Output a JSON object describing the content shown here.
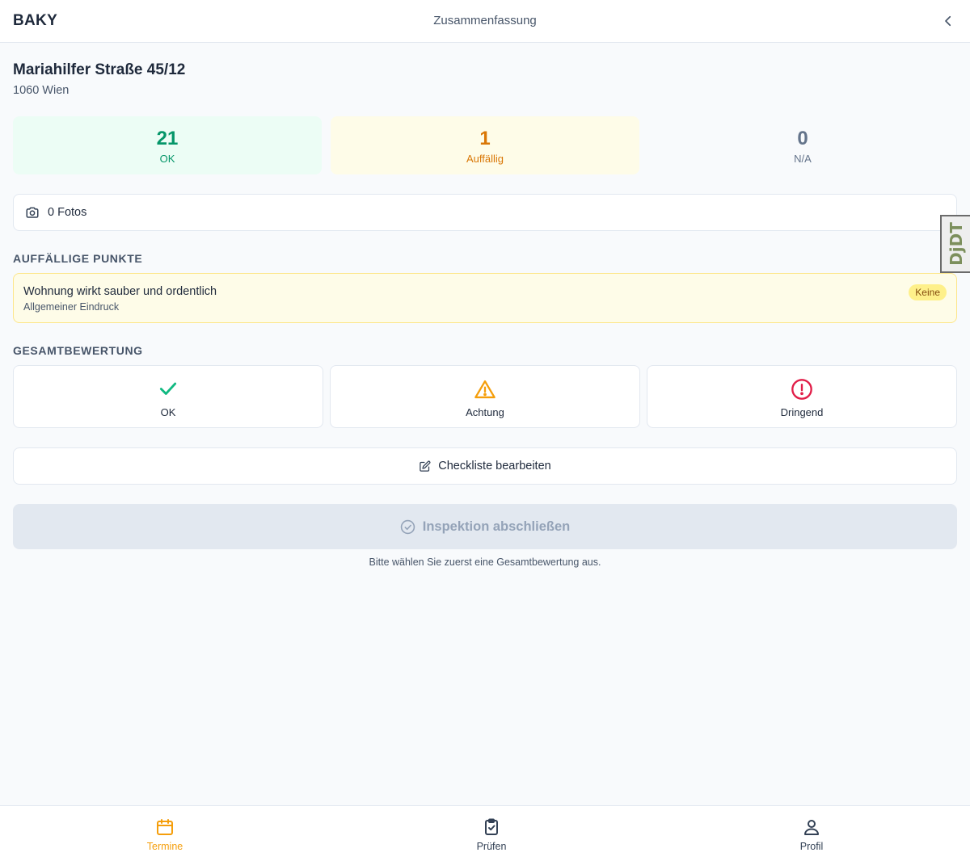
{
  "header": {
    "brand": "BAKY",
    "title": "Zusammenfassung"
  },
  "address": {
    "street": "Mariahilfer Straße 45/12",
    "city": "1060 Wien"
  },
  "stats": [
    {
      "value": "21",
      "label": "OK"
    },
    {
      "value": "1",
      "label": "Auffällig"
    },
    {
      "value": "0",
      "label": "N/A"
    }
  ],
  "photos": {
    "label": "0 Fotos"
  },
  "findings": {
    "section_title": "AUFFÄLLIGE PUNKTE",
    "items": [
      {
        "title": "Wohnung wirkt sauber und ordentlich",
        "category": "Allgemeiner Eindruck",
        "badge": "Keine"
      }
    ]
  },
  "rating": {
    "section_title": "GESAMTBEWERTUNG",
    "options": [
      {
        "label": "OK",
        "icon": "check-icon",
        "color": "#10b981"
      },
      {
        "label": "Achtung",
        "icon": "warning-triangle-icon",
        "color": "#f59e0b"
      },
      {
        "label": "Dringend",
        "icon": "alert-circle-icon",
        "color": "#e11d48"
      }
    ]
  },
  "actions": {
    "edit_label": "Checkliste bearbeiten",
    "finish_label": "Inspektion abschließen",
    "finish_hint": "Bitte wählen Sie zuerst eine Gesamtbewertung aus."
  },
  "debug_toolbar": {
    "label": "DjDT"
  },
  "bottom_nav": [
    {
      "label": "Termine",
      "icon": "calendar-icon",
      "active": true
    },
    {
      "label": "Prüfen",
      "icon": "clipboard-check-icon",
      "active": false
    },
    {
      "label": "Profil",
      "icon": "user-icon",
      "active": false
    }
  ],
  "colors": {
    "accent": "#f59e0b",
    "ok": "#059669",
    "warning": "#d97706",
    "danger": "#e11d48"
  }
}
